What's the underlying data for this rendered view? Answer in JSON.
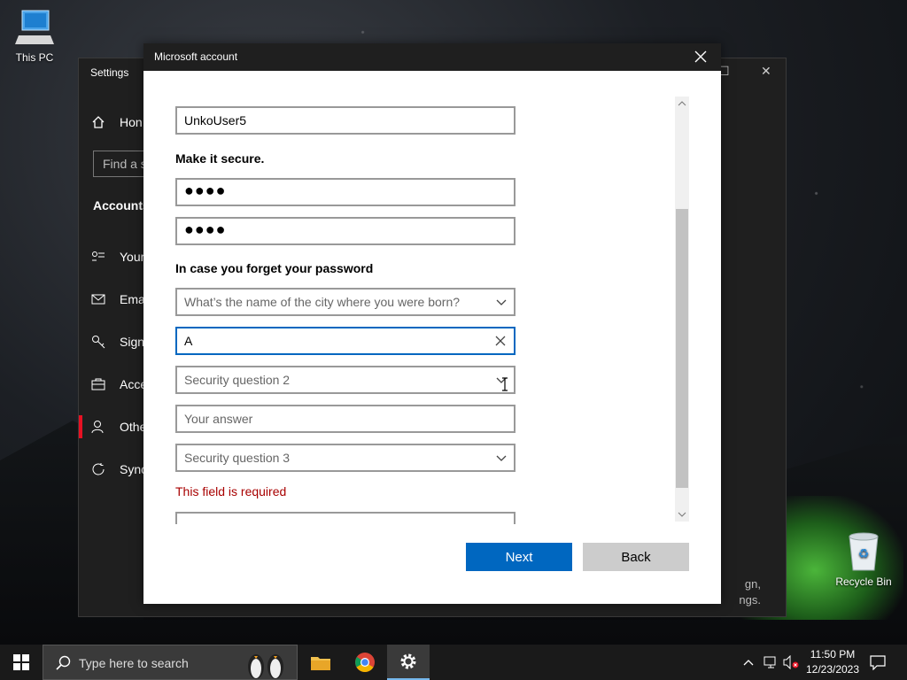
{
  "desktop": {
    "this_pc_label": "This PC",
    "recycle_bin_label": "Recycle Bin"
  },
  "settings": {
    "title": "Settings",
    "find_placeholder": "Find a s",
    "section": "Accounts",
    "nav": [
      "Hon",
      "Your",
      "Ema",
      "Sign",
      "Acce",
      "Othe",
      "Sync"
    ],
    "bottom_text_1": "gn,",
    "bottom_text_2": "ngs."
  },
  "dialog": {
    "title": "Microsoft account",
    "username_value": "UnkoUser5",
    "secure_heading": "Make it secure.",
    "password_dots": "●●●●",
    "confirm_dots": "●●●●",
    "forgot_heading": "In case you forget your password",
    "question1_selected": "What’s the name of the city where you were born?",
    "answer1_value": "A",
    "question2_placeholder": "Security question 2",
    "answer2_placeholder": "Your answer",
    "question3_placeholder": "Security question 3",
    "error_text": "This field is required",
    "next_label": "Next",
    "back_label": "Back"
  },
  "taskbar": {
    "search_placeholder": "Type here to search",
    "time": "11:50 PM",
    "date": "12/23/2023"
  },
  "colors": {
    "accent": "#0067c0",
    "error": "#a80000",
    "titlebar": "#1f1f1f"
  }
}
